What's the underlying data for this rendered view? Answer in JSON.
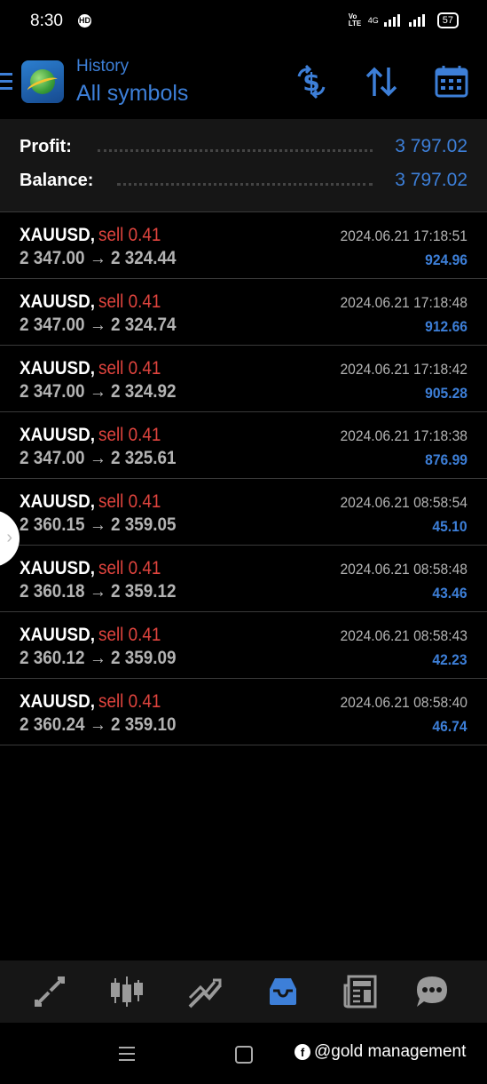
{
  "status": {
    "time": "8:30",
    "hd": "HD",
    "volte": "Vo LTE",
    "network": "4G",
    "battery": "57"
  },
  "header": {
    "subtitle": "History",
    "title": "All symbols"
  },
  "summary": {
    "profit_label": "Profit:",
    "profit_value": "3 797.02",
    "balance_label": "Balance:",
    "balance_value": "3 797.02"
  },
  "deals": [
    {
      "symbol": "XAUUSD,",
      "type": "sell 0.41",
      "prices": "2 347.00 → 2 324.44",
      "datetime": "2024.06.21 17:18:51",
      "profit": "924.96"
    },
    {
      "symbol": "XAUUSD,",
      "type": "sell 0.41",
      "prices": "2 347.00 → 2 324.74",
      "datetime": "2024.06.21 17:18:48",
      "profit": "912.66"
    },
    {
      "symbol": "XAUUSD,",
      "type": "sell 0.41",
      "prices": "2 347.00 → 2 324.92",
      "datetime": "2024.06.21 17:18:42",
      "profit": "905.28"
    },
    {
      "symbol": "XAUUSD,",
      "type": "sell 0.41",
      "prices": "2 347.00 → 2 325.61",
      "datetime": "2024.06.21 17:18:38",
      "profit": "876.99"
    },
    {
      "symbol": "XAUUSD,",
      "type": "sell 0.41",
      "prices": "2 360.15 → 2 359.05",
      "datetime": "2024.06.21 08:58:54",
      "profit": "45.10"
    },
    {
      "symbol": "XAUUSD,",
      "type": "sell 0.41",
      "prices": "2 360.18 → 2 359.12",
      "datetime": "2024.06.21 08:58:48",
      "profit": "43.46"
    },
    {
      "symbol": "XAUUSD,",
      "type": "sell 0.41",
      "prices": "2 360.12 → 2 359.09",
      "datetime": "2024.06.21 08:58:43",
      "profit": "42.23"
    },
    {
      "symbol": "XAUUSD,",
      "type": "sell 0.41",
      "prices": "2 360.24 → 2 359.10",
      "datetime": "2024.06.21 08:58:40",
      "profit": "46.74"
    }
  ],
  "icons": {
    "header": [
      "currency-swap-icon",
      "sort-icon",
      "calendar-icon"
    ],
    "bottom_nav": [
      "quotes-icon",
      "chart-icon",
      "trade-icon",
      "history-icon",
      "news-icon",
      "messages-icon"
    ]
  },
  "colors": {
    "accent": "#3d7fd8",
    "sell": "#e0443e",
    "text_secondary": "#b3b3b3"
  },
  "watermark": "@gold management"
}
